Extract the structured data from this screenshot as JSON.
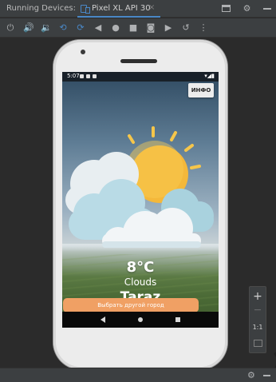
{
  "ide": {
    "panel_label": "Running Devices:",
    "tab_label": "Pixel XL API 30",
    "tab_close": "×",
    "title_icons": [
      "window-icon",
      "gear-icon",
      "minimize-icon"
    ],
    "toolbar_icons": [
      "power-icon",
      "volume-up-icon",
      "volume-down-icon",
      "rotate-left-icon",
      "rotate-right-icon",
      "back-icon",
      "home-icon",
      "overview-icon",
      "camera-icon",
      "video-icon",
      "restore-icon",
      "more-icon"
    ]
  },
  "device": {
    "status": {
      "time": "5:07",
      "right": "▾◢▮"
    },
    "info_button": "ИНФО",
    "weather": {
      "temperature": "8°C",
      "condition": "Clouds",
      "city": "Taraz"
    },
    "change_city_button": "Выбрать другой город"
  },
  "zoom": {
    "zoom_in": "+",
    "zoom_out": "—",
    "actual_size": "1:1"
  },
  "colors": {
    "ide_background": "#2b2b2b",
    "panel": "#3c3f41",
    "accent": "#4a88c7",
    "button_orange": "#f0a064",
    "sun": "#f4b83a"
  }
}
